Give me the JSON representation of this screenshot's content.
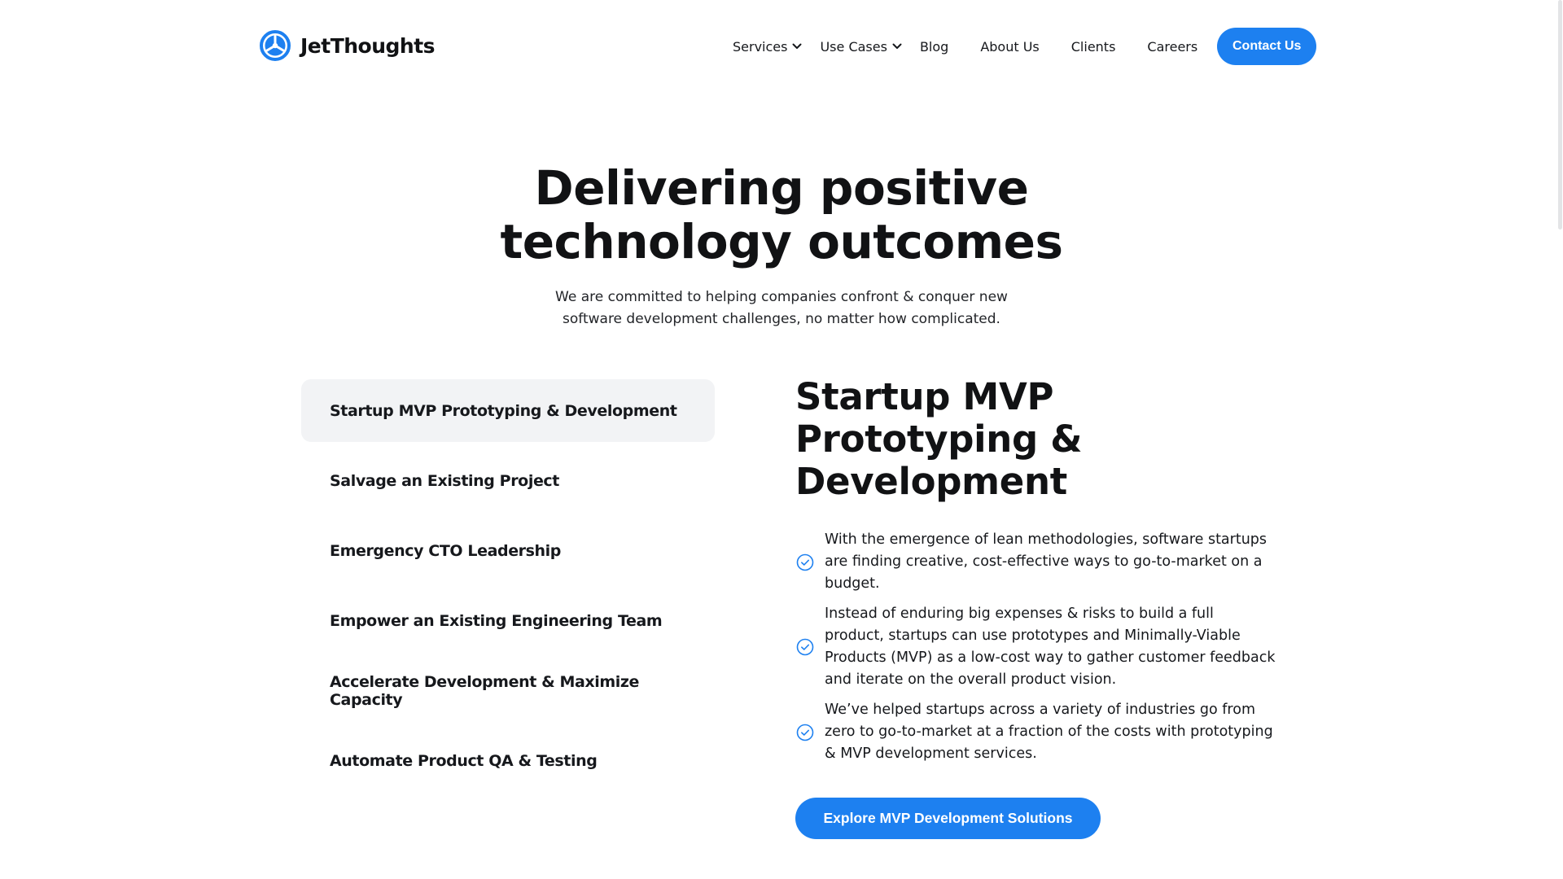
{
  "brand": {
    "name": "JetThoughts",
    "accent_color": "#1d80f0"
  },
  "nav": {
    "items": [
      {
        "label": "Services",
        "has_dropdown": true
      },
      {
        "label": "Use Cases",
        "has_dropdown": true
      },
      {
        "label": "Blog"
      },
      {
        "label": "About Us"
      },
      {
        "label": "Clients"
      },
      {
        "label": "Careers"
      }
    ],
    "cta_label": "Contact Us"
  },
  "hero": {
    "title_line1": "Delivering positive",
    "title_line2": "technology outcomes",
    "subtitle_line1": "We are committed to helping companies confront & conquer new",
    "subtitle_line2": "software development challenges, no matter how complicated."
  },
  "tabs": {
    "active_index": 0,
    "items": [
      {
        "label": "Startup MVP Prototyping & Development"
      },
      {
        "label": "Salvage an Existing Project"
      },
      {
        "label": "Emergency CTO Leadership"
      },
      {
        "label": "Empower an Existing Engineering Team"
      },
      {
        "label": "Accelerate Development & Maximize Capacity"
      },
      {
        "label": "Automate Product QA & Testing"
      }
    ]
  },
  "detail": {
    "title": "Startup MVP Prototyping & Development",
    "bullets": [
      {
        "text": "With the emergence of lean methodologies, software startups are finding creative, cost-effective ways to go-to-market on a budget."
      },
      {
        "text": "Instead of enduring big expenses & risks to build a full product, startups can use prototypes and Minimally-Viable Products (MVP) as a low-cost way to gather customer feedback and iterate on the overall product vision."
      },
      {
        "text": "We’ve helped startups across a variety of industries go from zero to go-to-market at a fraction of the costs with prototyping & MVP development services."
      }
    ],
    "button_label": "Explore MVP Development Solutions"
  },
  "icons": {
    "logo": "jetthoughts-logo-icon",
    "dropdown": "chevron-down-icon",
    "bullet": "check-circle-icon"
  }
}
